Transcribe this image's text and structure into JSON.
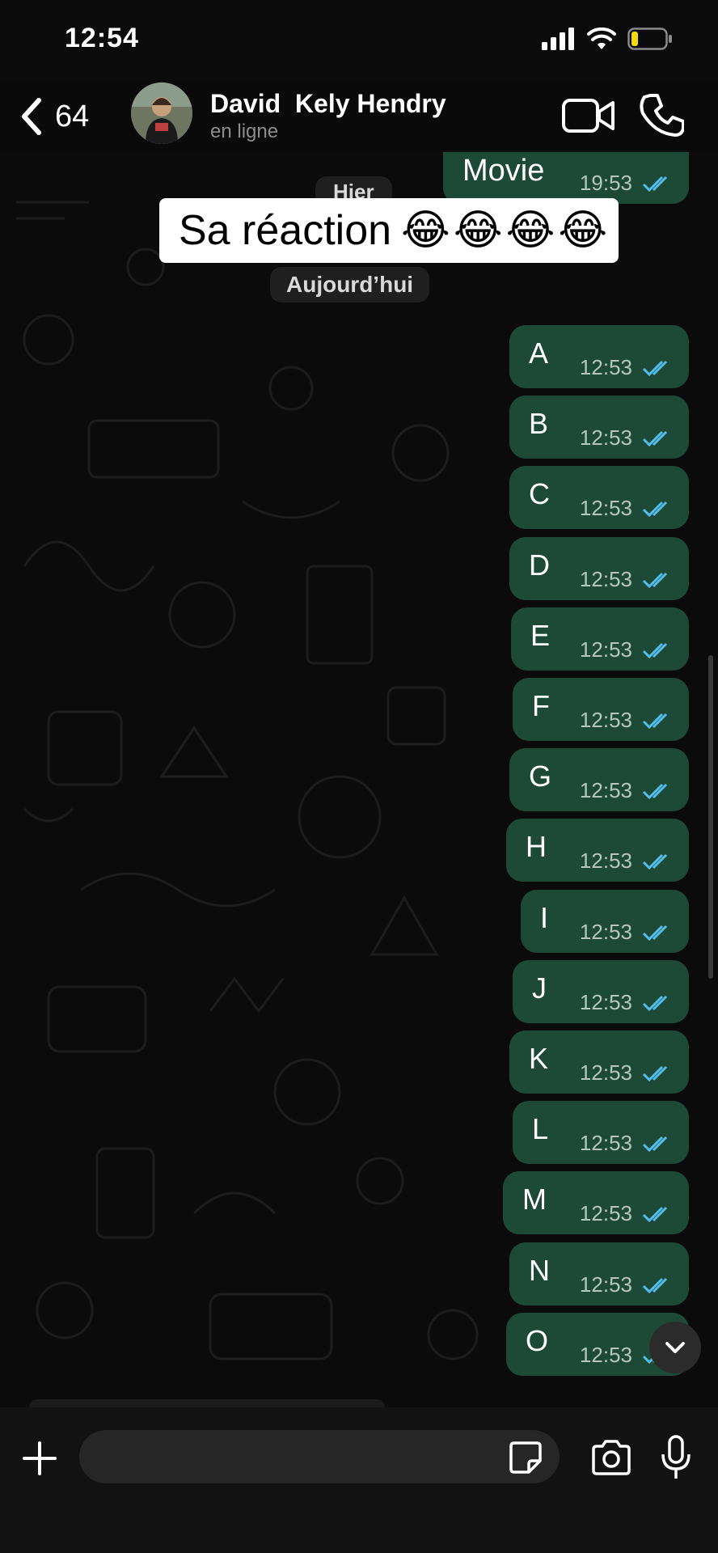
{
  "status_bar": {
    "time": "12:54"
  },
  "header": {
    "back_count": "64",
    "contact_name": "David  Kely Hendry",
    "contact_status": "en ligne"
  },
  "overlay_caption": "Sa réaction",
  "overlay_emojis": [
    "😂",
    "😂",
    "😂",
    "😂"
  ],
  "date_separators": {
    "yesterday": "Hier",
    "today": "Aujourd’hui"
  },
  "previous_message": {
    "text": "Movie",
    "time": "19:53"
  },
  "messages": [
    {
      "text": "A",
      "time": "12:53"
    },
    {
      "text": "B",
      "time": "12:53"
    },
    {
      "text": "C",
      "time": "12:53"
    },
    {
      "text": "D",
      "time": "12:53"
    },
    {
      "text": "E",
      "time": "12:53"
    },
    {
      "text": "F",
      "time": "12:53"
    },
    {
      "text": "G",
      "time": "12:53"
    },
    {
      "text": "H",
      "time": "12:53"
    },
    {
      "text": "I",
      "time": "12:53"
    },
    {
      "text": "J",
      "time": "12:53"
    },
    {
      "text": "K",
      "time": "12:53"
    },
    {
      "text": "L",
      "time": "12:53"
    },
    {
      "text": "M",
      "time": "12:53"
    },
    {
      "text": "N",
      "time": "12:53"
    },
    {
      "text": "O",
      "time": "12:53"
    }
  ],
  "input": {
    "placeholder": ""
  },
  "colors": {
    "bubble_outgoing": "#1d4a37",
    "read_ticks": "#53bdeb",
    "background": "#0b0b0b",
    "battery_low": "#f5d90a"
  },
  "icons": [
    "signal-icon",
    "wifi-icon",
    "battery-icon",
    "back-chevron-icon",
    "video-call-icon",
    "phone-icon",
    "plus-icon",
    "sticker-icon",
    "camera-icon",
    "microphone-icon",
    "chevron-down-icon",
    "double-check-icon"
  ]
}
